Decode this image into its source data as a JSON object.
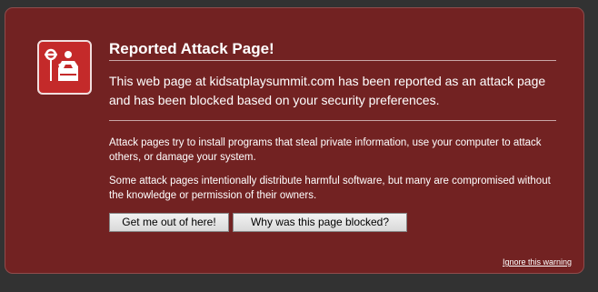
{
  "warning": {
    "title": "Reported Attack Page!",
    "lead": "This web page at kidsatplaysummit.com has been reported as an attack page and has been blocked based on your security preferences.",
    "para1": "Attack pages try to install programs that steal private information, use your computer to attack others, or damage your system.",
    "para2": "Some attack pages intentionally distribute harmful software, but many are compromised without the knowledge or permission of their owners.",
    "get_me_out_label": "Get me out of here!",
    "why_blocked_label": "Why was this page blocked?",
    "ignore_label": "Ignore this warning",
    "icon": "stop-policeman-icon"
  },
  "colors": {
    "background": "#323232",
    "panel": "#722222",
    "icon_bg": "#c42a2a"
  }
}
